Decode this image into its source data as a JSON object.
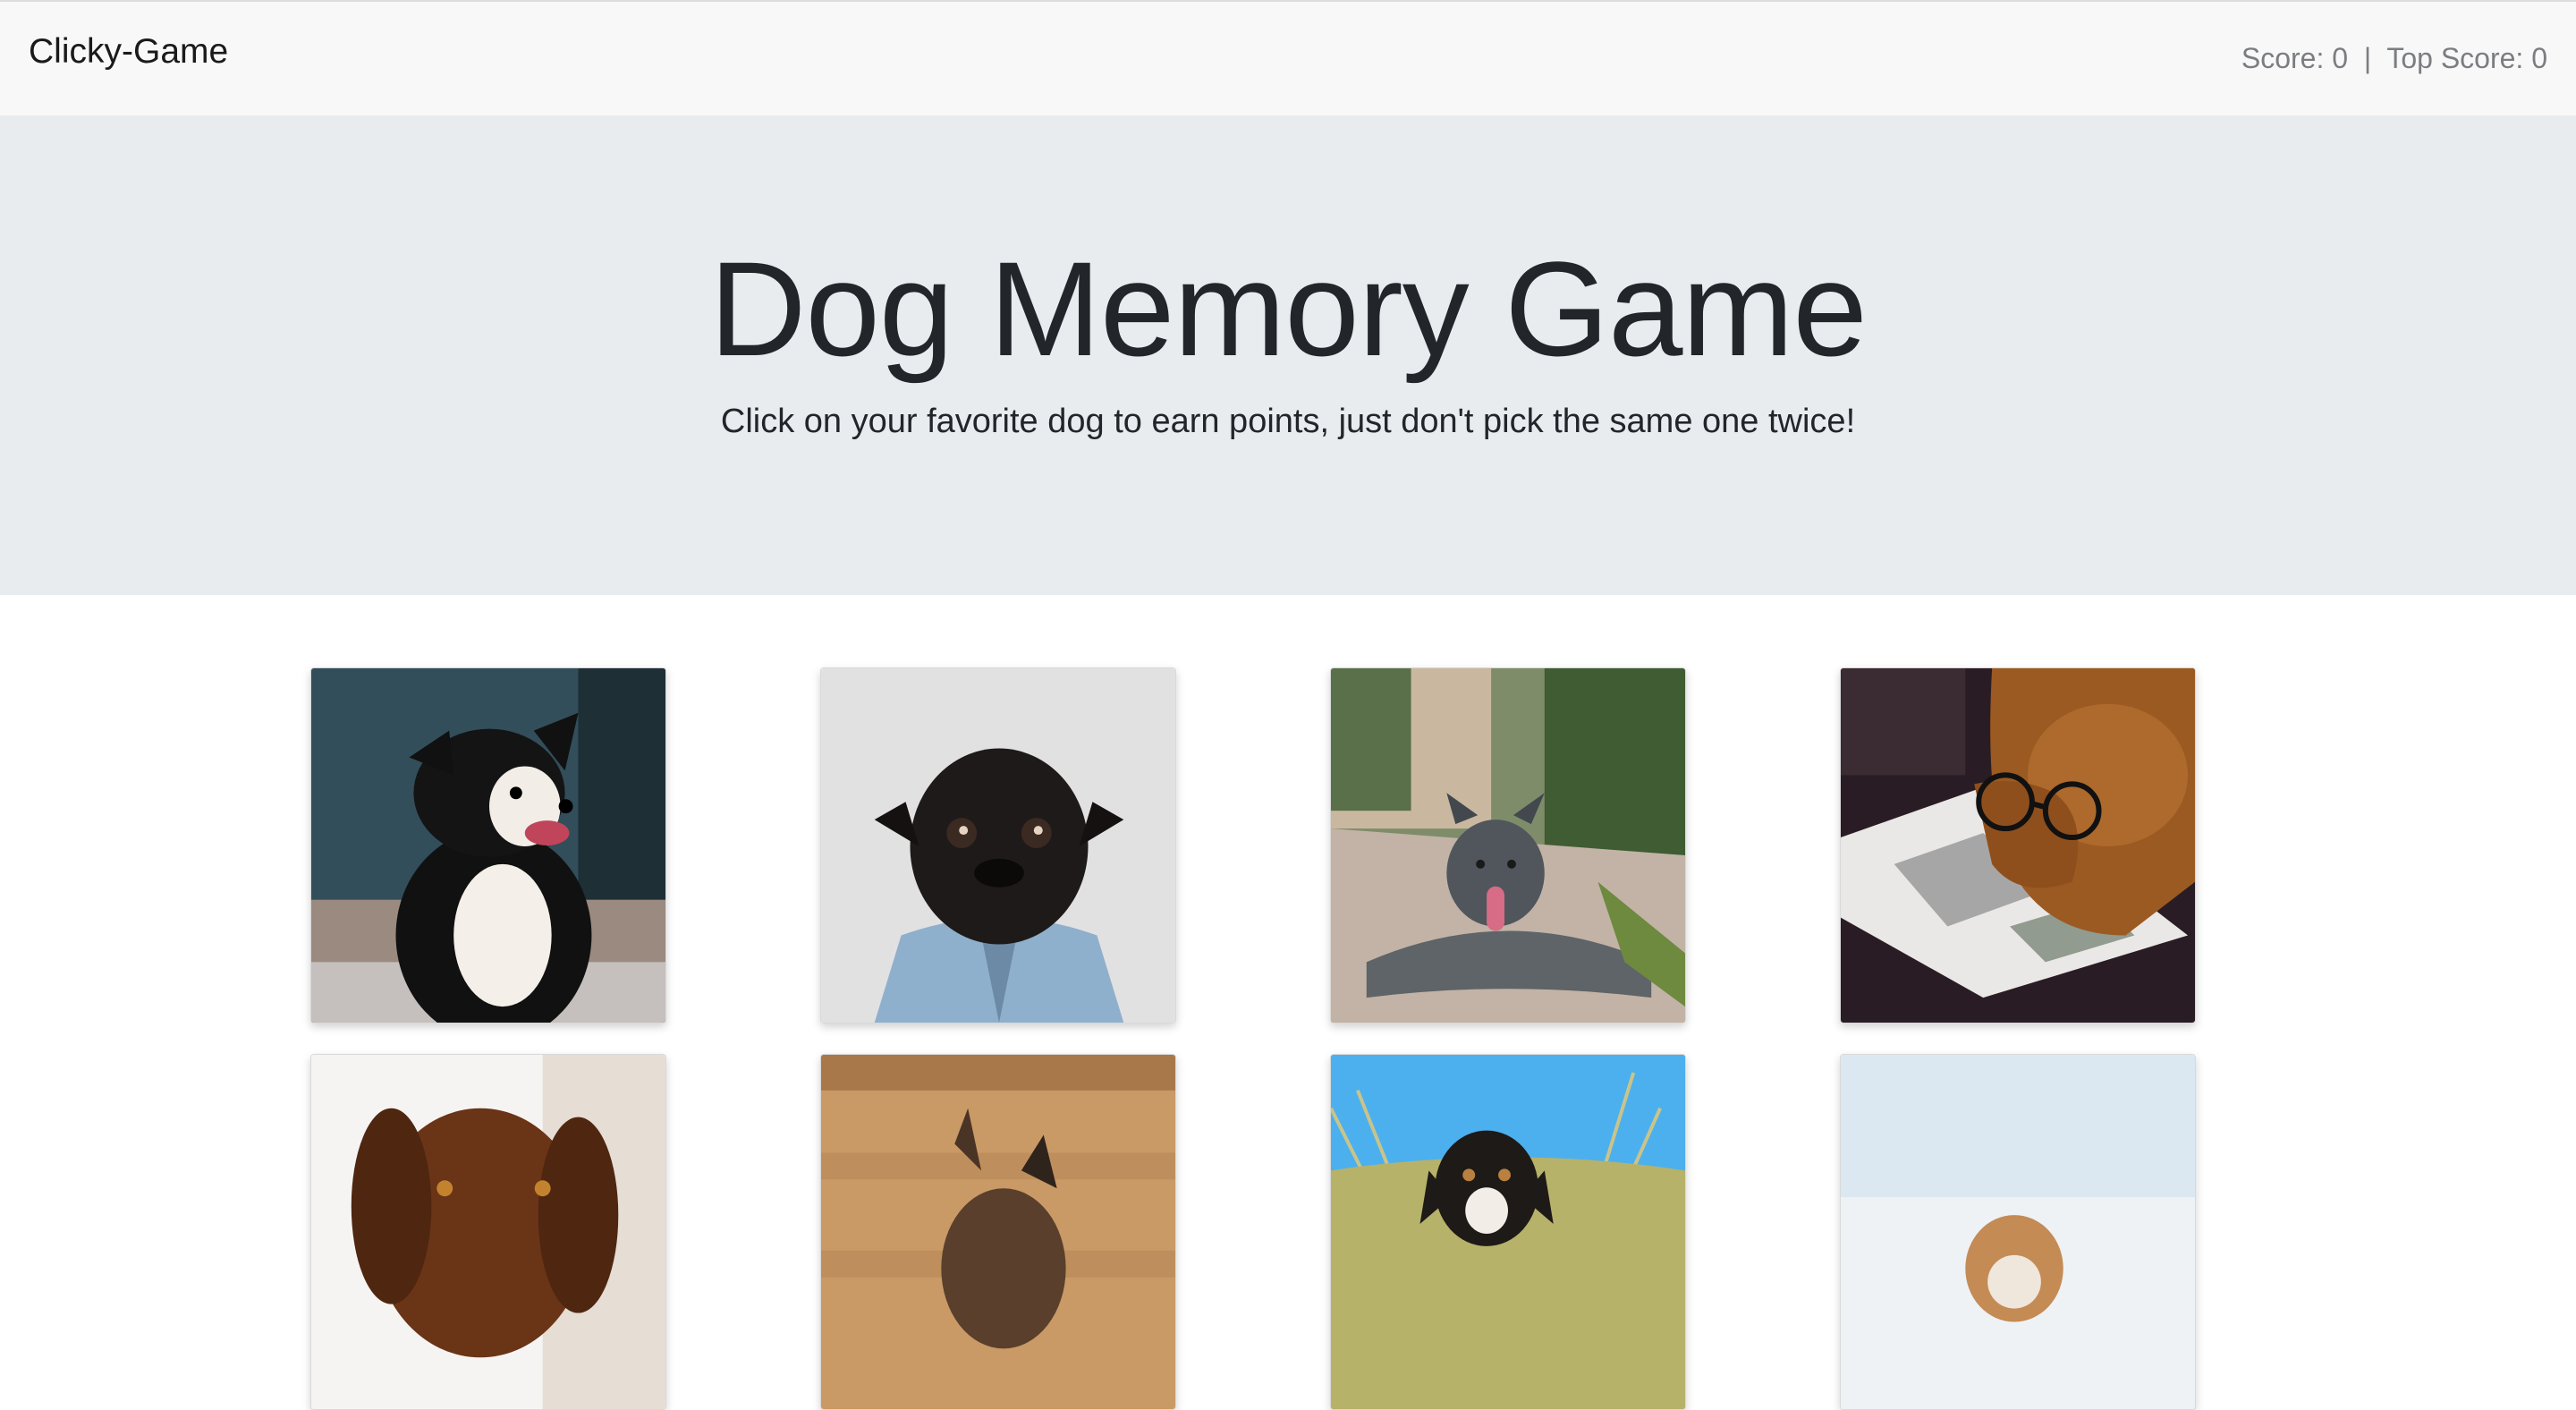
{
  "navbar": {
    "brand": "Clicky-Game",
    "score_text": "Score: 0  |  Top Score: 0"
  },
  "header": {
    "title": "Dog Memory Game",
    "instructions": "Click on your favorite dog to earn points, just don't pick the same one twice!"
  },
  "cards": [
    {
      "icon": "border-collie-image"
    },
    {
      "icon": "pug-in-denim-jacket-image"
    },
    {
      "icon": "pit-bull-lying-on-path-image"
    },
    {
      "icon": "dog-with-glasses-reading-magazine-image"
    },
    {
      "icon": "brown-spaniel-image"
    },
    {
      "icon": "dog-on-wood-background-image"
    },
    {
      "icon": "dog-on-beach-grass-image"
    },
    {
      "icon": "dog-on-pale-background-image"
    }
  ]
}
